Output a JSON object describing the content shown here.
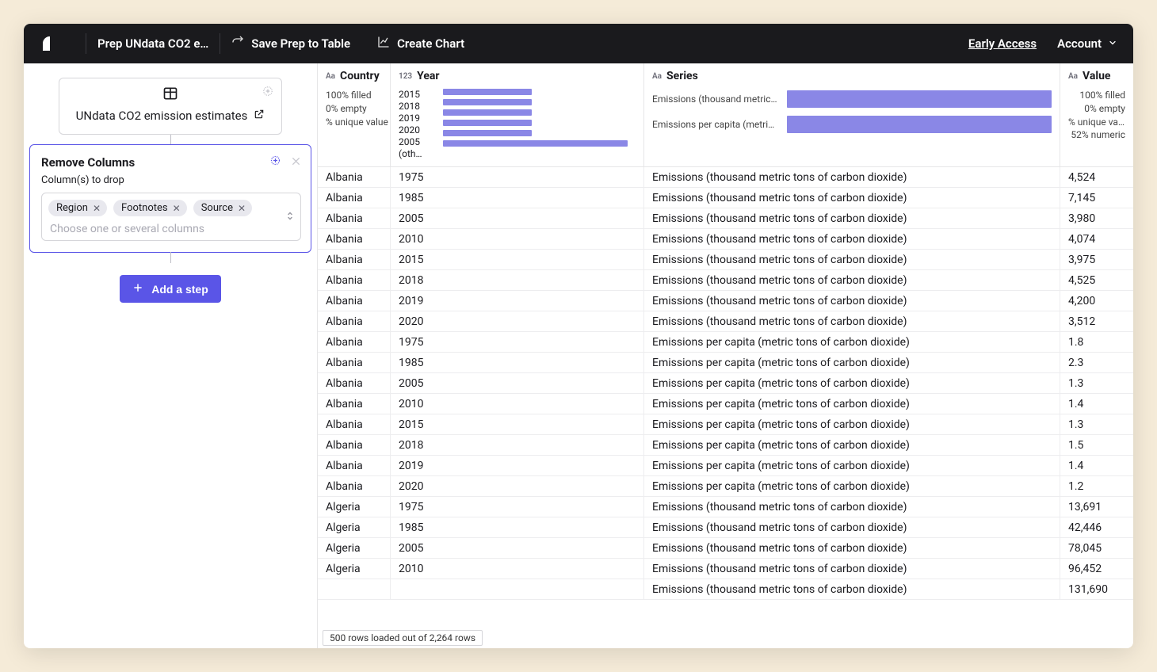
{
  "topbar": {
    "title": "Prep UNdata CO2 e…",
    "save_label": "Save Prep to Table",
    "chart_label": "Create Chart",
    "early_access": "Early Access",
    "account_label": "Account"
  },
  "pipeline": {
    "source_name": "UNdata CO2 emission estimates",
    "step_title": "Remove Columns",
    "step_subtitle": "Column(s) to drop",
    "chips": [
      "Region",
      "Footnotes",
      "Source"
    ],
    "chip_placeholder": "Choose one or several columns",
    "add_step_label": "Add a step"
  },
  "columns": {
    "0": {
      "name": "Country",
      "type": "Aa",
      "stats": [
        "100% filled",
        "0% empty",
        "% unique value"
      ]
    },
    "1": {
      "name": "Year",
      "type": "123",
      "years": [
        "2015",
        "2018",
        "2019",
        "2020",
        "2005",
        "(oth…"
      ],
      "bars": [
        46,
        46,
        46,
        46,
        46,
        96
      ]
    },
    "2": {
      "name": "Series",
      "type": "Aa",
      "series": [
        {
          "label": "Emissions (thousand metric to…",
          "pct": 100
        },
        {
          "label": "Emissions per capita (metric t…",
          "pct": 100
        }
      ]
    },
    "3": {
      "name": "Value",
      "type": "Aa",
      "stats": [
        "100% filled",
        "0% empty",
        "% unique value",
        "52% numeric"
      ]
    }
  },
  "rows": [
    {
      "country": "Albania",
      "year": "1975",
      "series": "Emissions (thousand metric tons of carbon dioxide)",
      "value": "4,524"
    },
    {
      "country": "Albania",
      "year": "1985",
      "series": "Emissions (thousand metric tons of carbon dioxide)",
      "value": "7,145"
    },
    {
      "country": "Albania",
      "year": "2005",
      "series": "Emissions (thousand metric tons of carbon dioxide)",
      "value": "3,980"
    },
    {
      "country": "Albania",
      "year": "2010",
      "series": "Emissions (thousand metric tons of carbon dioxide)",
      "value": "4,074"
    },
    {
      "country": "Albania",
      "year": "2015",
      "series": "Emissions (thousand metric tons of carbon dioxide)",
      "value": "3,975"
    },
    {
      "country": "Albania",
      "year": "2018",
      "series": "Emissions (thousand metric tons of carbon dioxide)",
      "value": "4,525"
    },
    {
      "country": "Albania",
      "year": "2019",
      "series": "Emissions (thousand metric tons of carbon dioxide)",
      "value": "4,200"
    },
    {
      "country": "Albania",
      "year": "2020",
      "series": "Emissions (thousand metric tons of carbon dioxide)",
      "value": "3,512"
    },
    {
      "country": "Albania",
      "year": "1975",
      "series": "Emissions per capita (metric tons of carbon dioxide)",
      "value": "1.8"
    },
    {
      "country": "Albania",
      "year": "1985",
      "series": "Emissions per capita (metric tons of carbon dioxide)",
      "value": "2.3"
    },
    {
      "country": "Albania",
      "year": "2005",
      "series": "Emissions per capita (metric tons of carbon dioxide)",
      "value": "1.3"
    },
    {
      "country": "Albania",
      "year": "2010",
      "series": "Emissions per capita (metric tons of carbon dioxide)",
      "value": "1.4"
    },
    {
      "country": "Albania",
      "year": "2015",
      "series": "Emissions per capita (metric tons of carbon dioxide)",
      "value": "1.3"
    },
    {
      "country": "Albania",
      "year": "2018",
      "series": "Emissions per capita (metric tons of carbon dioxide)",
      "value": "1.5"
    },
    {
      "country": "Albania",
      "year": "2019",
      "series": "Emissions per capita (metric tons of carbon dioxide)",
      "value": "1.4"
    },
    {
      "country": "Albania",
      "year": "2020",
      "series": "Emissions per capita (metric tons of carbon dioxide)",
      "value": "1.2"
    },
    {
      "country": "Algeria",
      "year": "1975",
      "series": "Emissions (thousand metric tons of carbon dioxide)",
      "value": "13,691"
    },
    {
      "country": "Algeria",
      "year": "1985",
      "series": "Emissions (thousand metric tons of carbon dioxide)",
      "value": "42,446"
    },
    {
      "country": "Algeria",
      "year": "2005",
      "series": "Emissions (thousand metric tons of carbon dioxide)",
      "value": "78,045"
    },
    {
      "country": "Algeria",
      "year": "2010",
      "series": "Emissions (thousand metric tons of carbon dioxide)",
      "value": "96,452"
    },
    {
      "country": "",
      "year": "",
      "series": "Emissions (thousand metric tons of carbon dioxide)",
      "value": "131,690"
    }
  ],
  "footer": "500 rows loaded out of 2,264 rows"
}
